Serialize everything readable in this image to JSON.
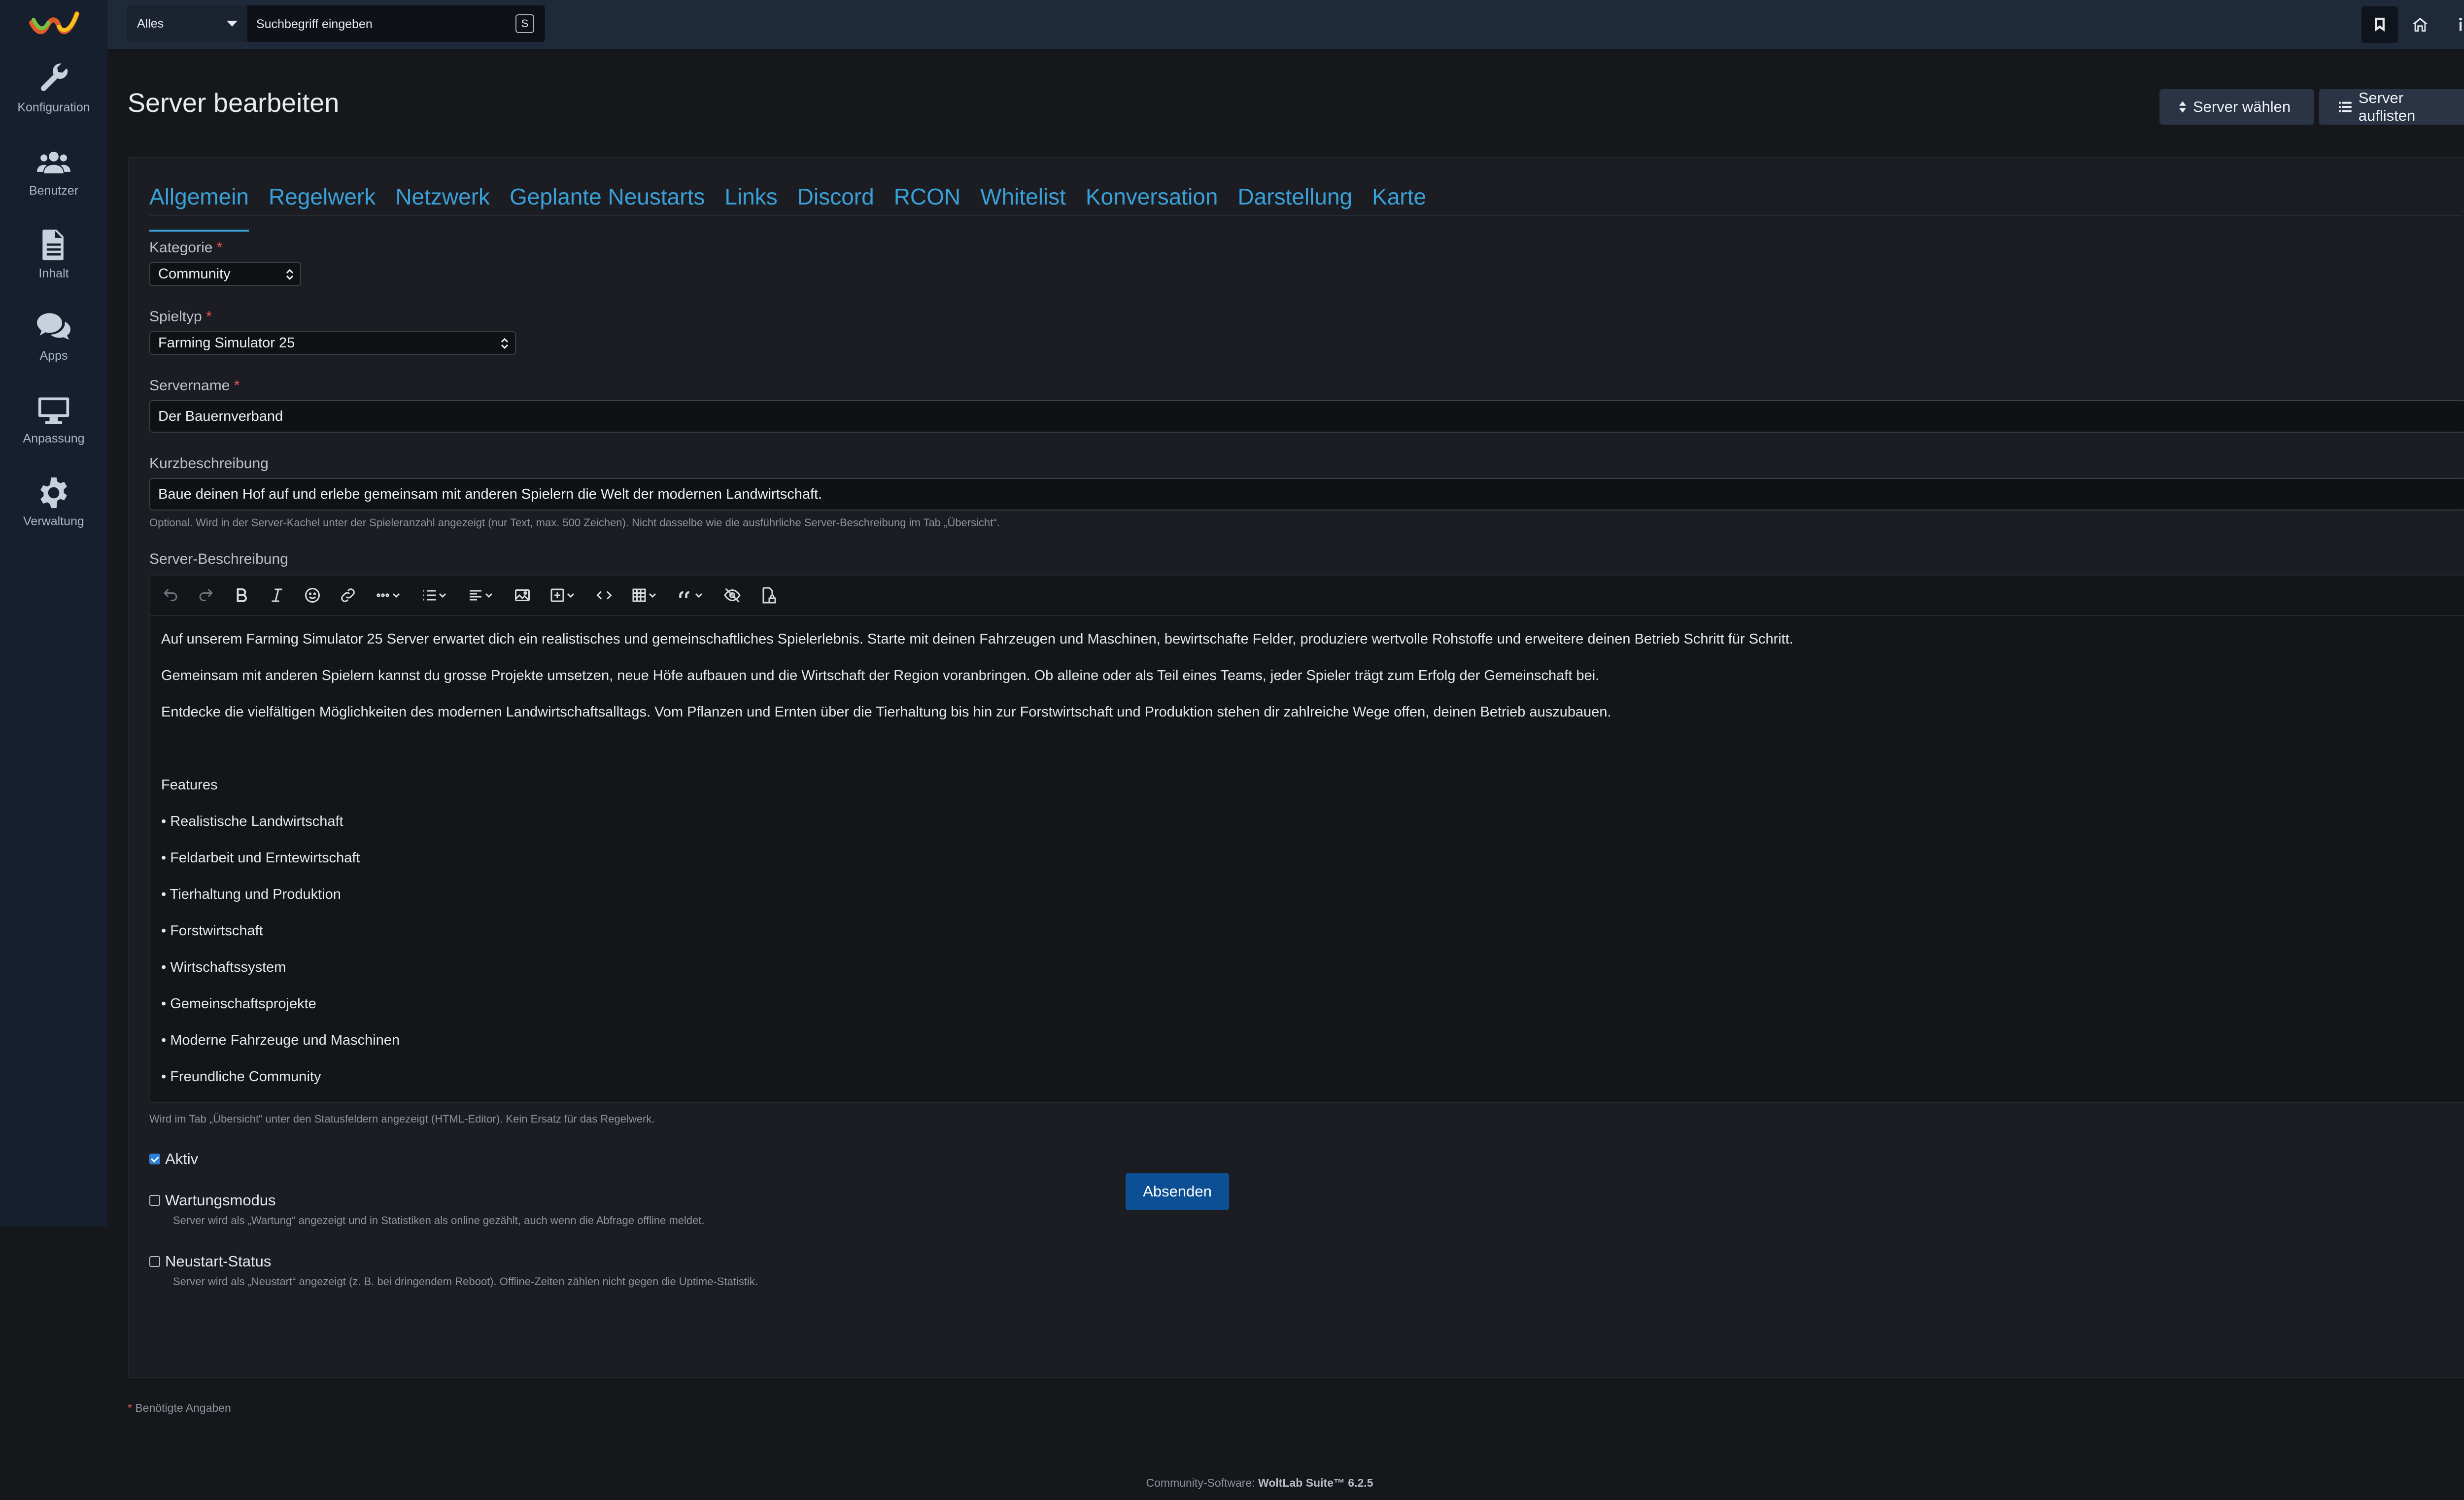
{
  "sidebar": {
    "items": [
      {
        "label": "Konfiguration",
        "icon": "wrench-icon"
      },
      {
        "label": "Benutzer",
        "icon": "users-icon"
      },
      {
        "label": "Inhalt",
        "icon": "document-icon"
      },
      {
        "label": "Apps",
        "icon": "comments-icon"
      },
      {
        "label": "Anpassung",
        "icon": "monitor-icon"
      },
      {
        "label": "Verwaltung",
        "icon": "gear-icon"
      }
    ]
  },
  "topbar": {
    "search_scope": "Alles",
    "search_placeholder": "Suchbegriff eingeben",
    "search_shortcut": "S"
  },
  "page": {
    "title": "Server bearbeiten",
    "btn_select": "Server wählen",
    "btn_list": "Server auflisten"
  },
  "tabs": [
    "Allgemein",
    "Regelwerk",
    "Netzwerk",
    "Geplante Neustarts",
    "Links",
    "Discord",
    "RCON",
    "Whitelist",
    "Konversation",
    "Darstellung",
    "Karte"
  ],
  "form": {
    "category_label": "Kategorie",
    "category_value": "Community",
    "gametype_label": "Spieltyp",
    "gametype_value": "Farming Simulator 25",
    "servername_label": "Servername",
    "servername_value": "Der Bauernverband",
    "short_desc_label": "Kurzbeschreibung",
    "short_desc_value": "Baue deinen Hof auf und erlebe gemeinsam mit anderen Spielern die Welt der modernen Landwirtschaft.",
    "short_desc_help": "Optional. Wird in der Server-Kachel unter der Spieleranzahl angezeigt (nur Text, max. 500 Zeichen). Nicht dasselbe wie die ausführliche Server-Beschreibung im Tab „Übersicht“.",
    "desc_label": "Server-Beschreibung",
    "desc_help": "Wird im Tab „Übersicht“ unter den Statusfeldern angezeigt (HTML-Editor). Kein Ersatz für das Regelwerk.",
    "required_mark": "*"
  },
  "editor": {
    "paragraphs": [
      "Auf unserem Farming Simulator 25 Server erwartet dich ein realistisches und gemeinschaftliches Spielerlebnis. Starte mit deinen Fahrzeugen und Maschinen, bewirtschafte Felder, produziere wertvolle Rohstoffe und erweitere deinen Betrieb Schritt für Schritt.",
      "Gemeinsam mit anderen Spielern kannst du grosse Projekte umsetzen, neue Höfe aufbauen und die Wirtschaft der Region voranbringen. Ob alleine oder als Teil eines Teams, jeder Spieler trägt zum Erfolg der Gemeinschaft bei.",
      "Entdecke die vielfältigen Möglichkeiten des modernen Landwirtschaftsalltags. Vom Pflanzen und Ernten über die Tierhaltung bis hin zur Forstwirtschaft und Produktion stehen dir zahlreiche Wege offen, deinen Betrieb auszubauen.",
      "",
      "Features",
      "• Realistische Landwirtschaft",
      "• Feldarbeit und Erntewirtschaft",
      "• Tierhaltung und Produktion",
      "• Forstwirtschaft",
      "• Wirtschaftssystem",
      "• Gemeinschaftsprojekte",
      "• Moderne Fahrzeuge und Maschinen",
      "• Freundliche Community"
    ]
  },
  "options": {
    "active_label": "Aktiv",
    "active_checked": true,
    "maintenance_label": "Wartungsmodus",
    "maintenance_help": "Server wird als „Wartung“ angezeigt und in Statistiken als online gezählt, auch wenn die Abfrage offline meldet.",
    "restart_label": "Neustart-Status",
    "restart_help": "Server wird als „Neustart“ angezeigt (z. B. bei dringendem Reboot). Offline-Zeiten zählen nicht gegen die Uptime-Statistik."
  },
  "submit_label": "Absenden",
  "required_note": "Benötigte Angaben",
  "footer": {
    "prefix": "Community-Software: ",
    "product": "WoltLab Suite™ 6.2.5"
  }
}
